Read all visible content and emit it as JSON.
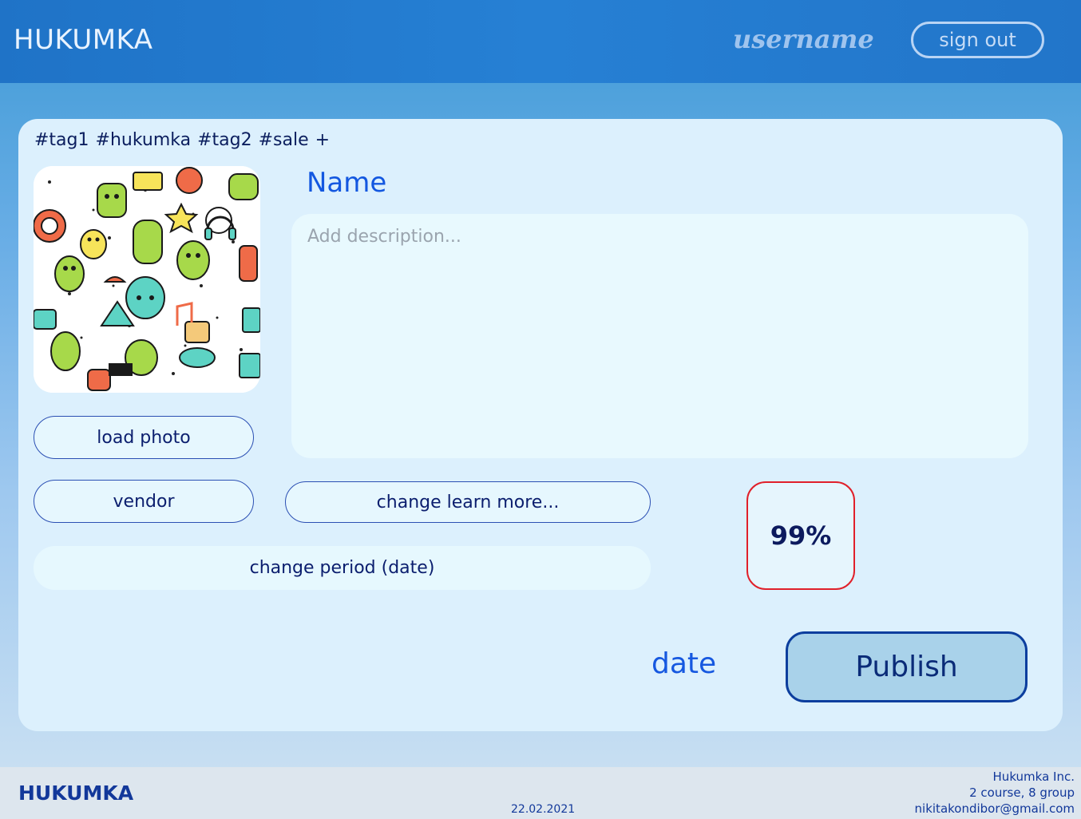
{
  "header": {
    "brand": "HUKUMKA",
    "username": "username",
    "sign_out_label": "sign out"
  },
  "card": {
    "tags": [
      "#tag1",
      "#hukumka",
      "#tag2",
      "#sale"
    ],
    "add_tag_label": "+",
    "name_title": "Name",
    "description": {
      "value": "",
      "placeholder": "Add description..."
    },
    "load_photo_label": "load photo",
    "vendor_label": "vendor",
    "learn_more_label": "change learn more...",
    "period_label": "change period (date)",
    "percent": "99%",
    "date_label": "date",
    "publish_label": "Publish"
  },
  "footer": {
    "brand": "HUKUMKA",
    "date": "22.02.2021",
    "company": "Hukumka Inc.",
    "group": "2 course, 8 group",
    "email": "nikitakondibor@gmail.com"
  },
  "colors": {
    "header": "#2680d4",
    "accent_blue": "#1658e0",
    "percent_border": "#e0202a",
    "publish_bg": "#a9d2ea"
  }
}
